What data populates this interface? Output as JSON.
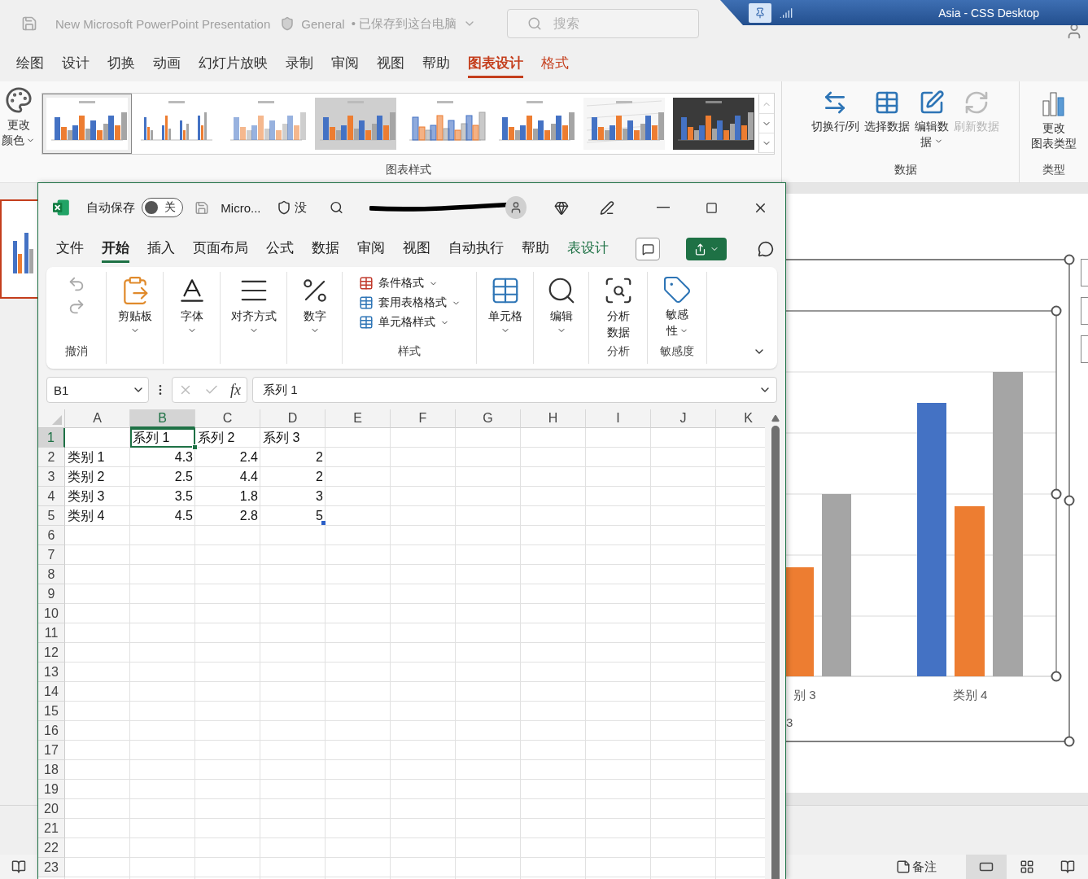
{
  "powerpoint": {
    "title": "New Microsoft PowerPoint Presentation",
    "sensitivity_label": "General",
    "save_status": "• 已保存到这台电脑",
    "search": {
      "placeholder": "搜索"
    },
    "remote_bar": {
      "title": "Asia - CSS Desktop"
    },
    "tabs": [
      {
        "label": "绘图",
        "selected": false,
        "contextual": false
      },
      {
        "label": "设计",
        "selected": false,
        "contextual": false
      },
      {
        "label": "切换",
        "selected": false,
        "contextual": false
      },
      {
        "label": "动画",
        "selected": false,
        "contextual": false
      },
      {
        "label": "幻灯片放映",
        "selected": false,
        "contextual": false
      },
      {
        "label": "录制",
        "selected": false,
        "contextual": false
      },
      {
        "label": "审阅",
        "selected": false,
        "contextual": false
      },
      {
        "label": "视图",
        "selected": false,
        "contextual": false
      },
      {
        "label": "帮助",
        "selected": false,
        "contextual": false
      },
      {
        "label": "图表设计",
        "selected": true,
        "contextual": true
      },
      {
        "label": "格式",
        "selected": false,
        "contextual": true
      }
    ],
    "ribbon": {
      "change_colors": [
        "更改",
        "颜色"
      ],
      "chart_styles_group": "图表样式",
      "chart_styles": [
        {
          "kind": "classic",
          "selected": true
        },
        {
          "kind": "thin",
          "selected": false
        },
        {
          "kind": "striped",
          "selected": false
        },
        {
          "kind": "shaded",
          "selected": false
        },
        {
          "kind": "outlined",
          "selected": false
        },
        {
          "kind": "classic",
          "selected": false
        },
        {
          "kind": "hatched",
          "selected": false
        },
        {
          "kind": "dark",
          "selected": false
        }
      ],
      "data_buttons": [
        {
          "label": "切换行/列",
          "disabled": false,
          "dropdown": false
        },
        {
          "label": "选择数据",
          "disabled": false,
          "dropdown": false
        },
        {
          "label": "编辑数据",
          "disabled": false,
          "dropdown": true
        },
        {
          "label": "刷新数据",
          "disabled": true,
          "dropdown": false
        }
      ],
      "data_group": "数据",
      "change_type": [
        "更改",
        "图表类型"
      ],
      "type_group": "类型"
    },
    "chart": {
      "category_labels": [
        "别 3",
        "类别 4"
      ],
      "legend_fragment": "3"
    },
    "status_bar": {
      "notes": "备注",
      "views": [
        {
          "selected": true
        },
        {
          "selected": false
        },
        {
          "selected": false
        }
      ]
    }
  },
  "excel": {
    "autosave_label": "自动保存",
    "autosave": {
      "on": false,
      "label": "关"
    },
    "file_name": "Micro...",
    "sensitivity": "没",
    "tabs": [
      {
        "label": "文件",
        "selected": false,
        "contextual": false
      },
      {
        "label": "开始",
        "selected": true,
        "contextual": false
      },
      {
        "label": "插入",
        "selected": false,
        "contextual": false
      },
      {
        "label": "页面布局",
        "selected": false,
        "contextual": false
      },
      {
        "label": "公式",
        "selected": false,
        "contextual": false
      },
      {
        "label": "数据",
        "selected": false,
        "contextual": false
      },
      {
        "label": "审阅",
        "selected": false,
        "contextual": false
      },
      {
        "label": "视图",
        "selected": false,
        "contextual": false
      },
      {
        "label": "自动执行",
        "selected": false,
        "contextual": false
      },
      {
        "label": "帮助",
        "selected": false,
        "contextual": false
      },
      {
        "label": "表设计",
        "selected": false,
        "contextual": true
      }
    ],
    "ribbon": {
      "undo_group": "撤消",
      "clipboard": "剪贴板",
      "font": "字体",
      "alignment": "对齐方式",
      "number": "数字",
      "styles": [
        "条件格式",
        "套用表格格式",
        "单元格样式"
      ],
      "styles_group": "样式",
      "cells": "单元格",
      "editing": "编辑",
      "analyze": [
        "分析",
        "数据"
      ],
      "analyze_group": "分析",
      "sensitivity": [
        "敏感",
        "性"
      ],
      "sensitivity_group": "敏感度"
    },
    "name_box": "B1",
    "fx": "fx",
    "formula": "系列 1",
    "columns": [
      {
        "label": "A",
        "selected": false
      },
      {
        "label": "B",
        "selected": true
      },
      {
        "label": "C",
        "selected": false
      },
      {
        "label": "D",
        "selected": false
      },
      {
        "label": "E",
        "selected": false
      },
      {
        "label": "F",
        "selected": false
      },
      {
        "label": "G",
        "selected": false
      },
      {
        "label": "H",
        "selected": false
      },
      {
        "label": "I",
        "selected": false
      },
      {
        "label": "J",
        "selected": false
      },
      {
        "label": "K",
        "selected": false
      }
    ],
    "rows": [
      {
        "number": "1",
        "selected": true,
        "cells": [
          null,
          {
            "text": "系列 1",
            "kind": "text",
            "selected": true
          },
          {
            "text": "系列 2",
            "kind": "text",
            "selected": false
          },
          {
            "text": "系列 3",
            "kind": "text",
            "selected": false
          }
        ]
      },
      {
        "number": "2",
        "selected": false,
        "cells": [
          {
            "text": "类别 1",
            "kind": "text",
            "selected": false
          },
          {
            "text": "4.3",
            "kind": "number",
            "selected": false
          },
          {
            "text": "2.4",
            "kind": "number",
            "selected": false
          },
          {
            "text": "2",
            "kind": "number",
            "selected": false
          }
        ]
      },
      {
        "number": "3",
        "selected": false,
        "cells": [
          {
            "text": "类别 2",
            "kind": "text",
            "selected": false
          },
          {
            "text": "2.5",
            "kind": "number",
            "selected": false
          },
          {
            "text": "4.4",
            "kind": "number",
            "selected": false
          },
          {
            "text": "2",
            "kind": "number",
            "selected": false
          }
        ]
      },
      {
        "number": "4",
        "selected": false,
        "cells": [
          {
            "text": "类别 3",
            "kind": "text",
            "selected": false
          },
          {
            "text": "3.5",
            "kind": "number",
            "selected": false
          },
          {
            "text": "1.8",
            "kind": "number",
            "selected": false
          },
          {
            "text": "3",
            "kind": "number",
            "selected": false
          }
        ]
      },
      {
        "number": "5",
        "selected": false,
        "cells": [
          {
            "text": "类别 4",
            "kind": "text",
            "selected": false
          },
          {
            "text": "4.5",
            "kind": "number",
            "selected": false
          },
          {
            "text": "2.8",
            "kind": "number",
            "selected": false
          },
          {
            "text": "5",
            "kind": "number",
            "selected": false,
            "resize_handle": true
          }
        ]
      },
      {
        "number": "6",
        "selected": false
      },
      {
        "number": "7",
        "selected": false
      },
      {
        "number": "8",
        "selected": false
      },
      {
        "number": "9",
        "selected": false
      },
      {
        "number": "10",
        "selected": false
      },
      {
        "number": "11",
        "selected": false
      },
      {
        "number": "12",
        "selected": false
      },
      {
        "number": "13",
        "selected": false
      },
      {
        "number": "14",
        "selected": false
      },
      {
        "number": "15",
        "selected": false
      },
      {
        "number": "16",
        "selected": false
      },
      {
        "number": "17",
        "selected": false
      },
      {
        "number": "18",
        "selected": false
      },
      {
        "number": "19",
        "selected": false
      },
      {
        "number": "20",
        "selected": false
      },
      {
        "number": "21",
        "selected": false
      },
      {
        "number": "22",
        "selected": false
      },
      {
        "number": "23",
        "selected": false
      }
    ]
  }
}
